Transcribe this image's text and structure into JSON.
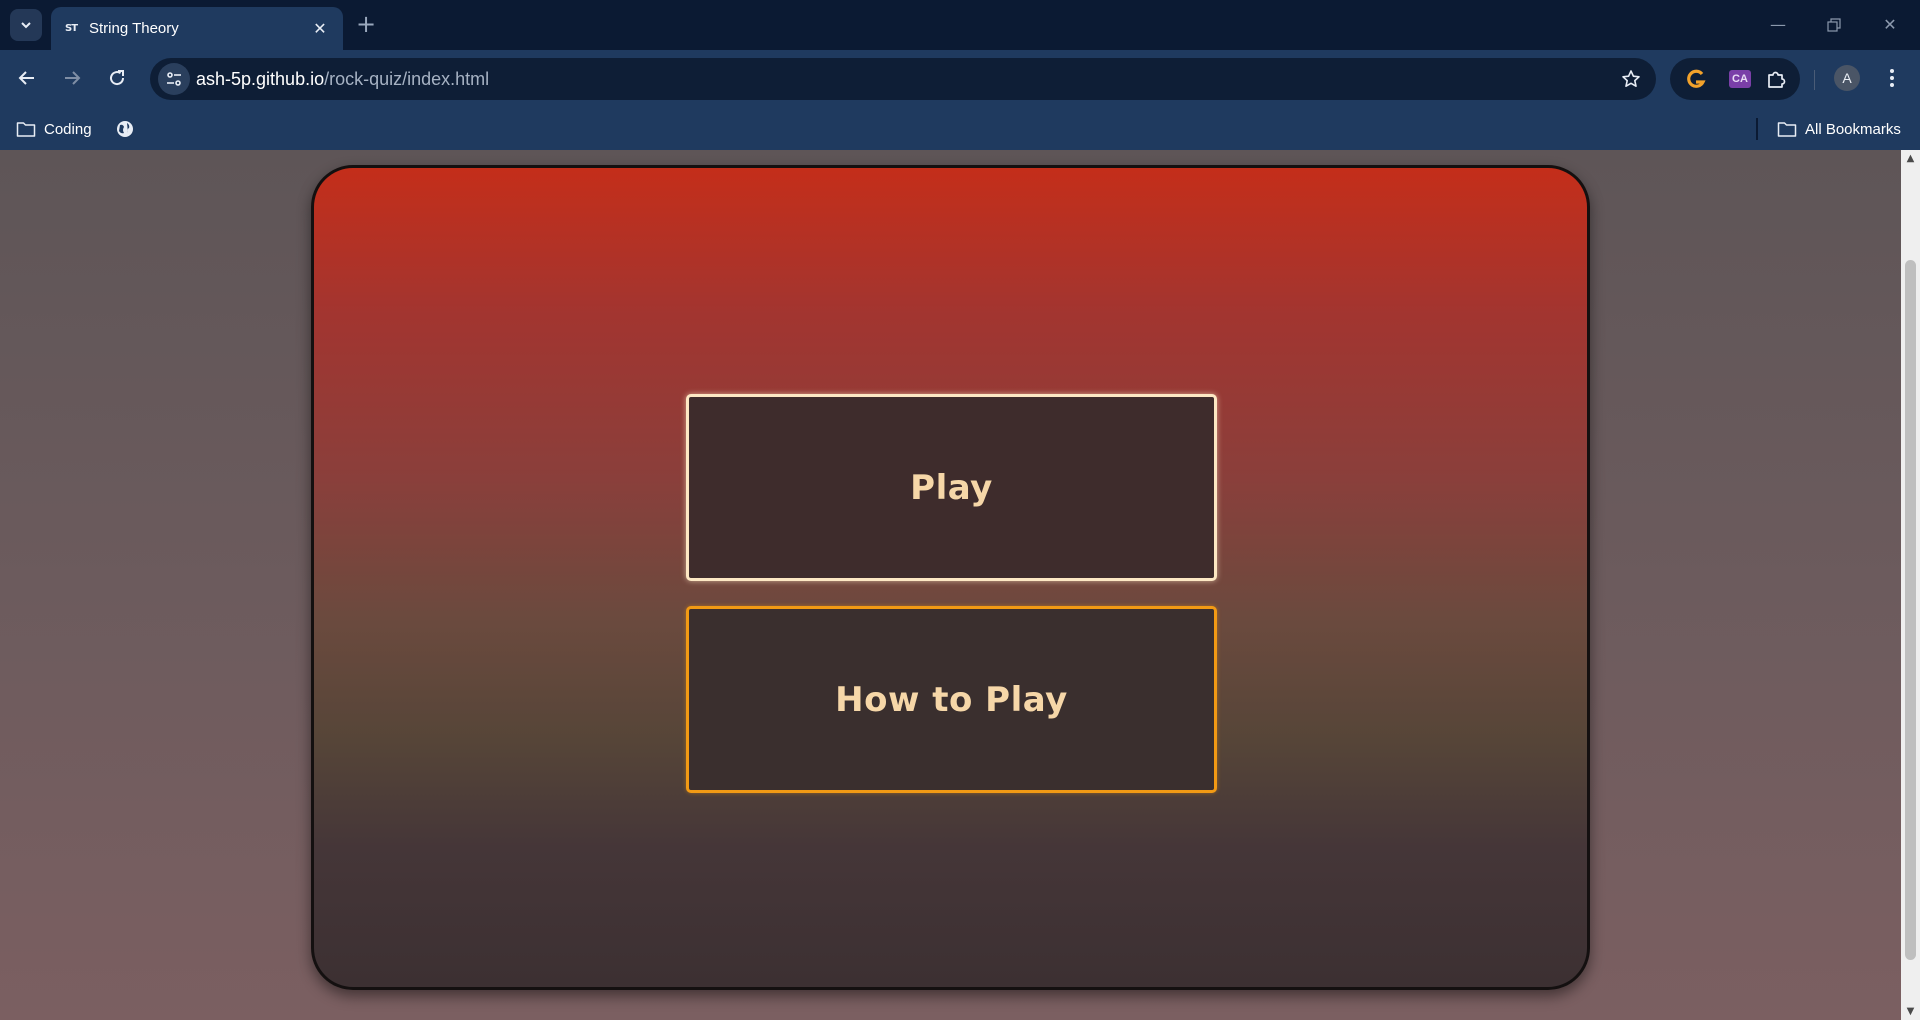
{
  "browser": {
    "tab": {
      "title": "String Theory",
      "favicon_text": "ST"
    },
    "url": {
      "domain": "ash-5p.github.io",
      "path": "/rock-quiz/index.html"
    },
    "profile_initial": "A",
    "extensions": [
      "grammarly-icon",
      "ca-extension-icon",
      "extensions-puzzle-icon"
    ],
    "bookmarks": [
      {
        "label": "Coding",
        "icon": "folder-icon"
      },
      {
        "label": "",
        "icon": "globe-icon"
      }
    ],
    "all_bookmarks_label": "All Bookmarks"
  },
  "page": {
    "menu": {
      "play_label": "Play",
      "how_to_play_label": "How to Play"
    }
  },
  "colors": {
    "card_top": "#c42e1a",
    "card_bottom": "#3c3032",
    "button_text": "#f6d7a8",
    "play_border": "#fde8c4",
    "how_border": "#f29a14"
  }
}
